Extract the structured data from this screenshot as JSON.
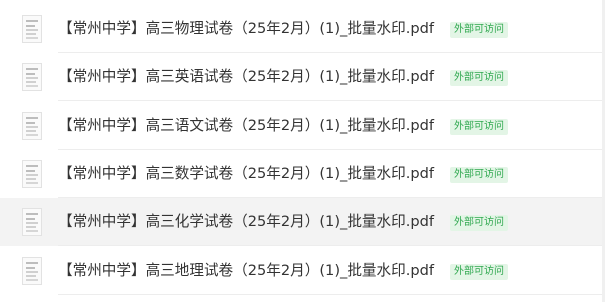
{
  "files": [
    {
      "name": "【常州中学】高三物理试卷（25年2月）(1)_批量水印.pdf",
      "badge": "外部可访问"
    },
    {
      "name": "【常州中学】高三英语试卷（25年2月）(1)_批量水印.pdf",
      "badge": "外部可访问"
    },
    {
      "name": "【常州中学】高三语文试卷（25年2月）(1)_批量水印.pdf",
      "badge": "外部可访问"
    },
    {
      "name": "【常州中学】高三数学试卷（25年2月）(1)_批量水印.pdf",
      "badge": "外部可访问"
    },
    {
      "name": "【常州中学】高三化学试卷（25年2月）(1)_批量水印.pdf",
      "badge": "外部可访问"
    },
    {
      "name": "【常州中学】高三地理试卷（25年2月）(1)_批量水印.pdf",
      "badge": "外部可访问"
    }
  ],
  "colors": {
    "badge_bg": "#e3f5e6",
    "badge_text": "#2fa84f",
    "hover_row_bg": "#f3f3f3"
  }
}
